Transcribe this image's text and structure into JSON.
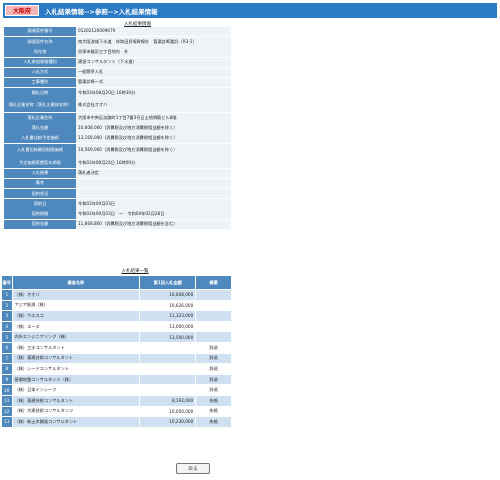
{
  "header": {
    "prefecture": "大阪府",
    "breadcrumb": "入札結果情報-->参照-->入札結果情報"
  },
  "detail": {
    "title": "入札結果情報",
    "rows": [
      {
        "label": "調達案件番号",
        "value": "01202120009679"
      },
      {
        "label": "調達案件名称",
        "value": "南大阪流域下水道　岸和田貝塚幹線外　管渠診断委託（R3-1）"
      },
      {
        "label": "所在地",
        "value": "貝塚市脇浜三丁目地内　外"
      },
      {
        "label": "入札参加資格種別",
        "value": "建設コンサルタント（下水道）"
      },
      {
        "label": "入札方式",
        "value": "一般競争入札"
      },
      {
        "label": "工事種別",
        "value": "管渠診断一式"
      },
      {
        "label": "開札日時",
        "value": "令和03年08月20日 16時30分"
      },
      {
        "label": "落札企業名称（落札企業体名称）",
        "value": "株式会社オオバ"
      },
      {
        "label": "落札企業住所",
        "value": "大阪市中央区淡路町1丁目7番3号日土地堺筋ビル8階"
      },
      {
        "label": "落札金額",
        "value": "10,608,000（消費税及び地方消費税相当額を除く）"
      },
      {
        "label": "入札書比較予定価格",
        "value": "13,169,000（消費税及び地方消費税相当額を除く）"
      },
      {
        "label": "入札書比較最低制限価格",
        "value": "10,569,000（消費税及び地方消費税相当額を除く）"
      },
      {
        "label": "予定価格等閲覧年期限",
        "value": "令和03年08月24日 16時00分"
      },
      {
        "label": "入札結果",
        "value": "落札者決定"
      },
      {
        "label": "備考",
        "value": ""
      },
      {
        "label": "契約状況",
        "value": ""
      },
      {
        "label": "契約日",
        "value": "令和03年09月03日"
      },
      {
        "label": "契約期間",
        "value": "令和03年09月03日　～　令和04年02月28日"
      },
      {
        "label": "契約金額",
        "value": "11,668,800（消費税及び地方消費税相当額を含む）"
      }
    ]
  },
  "results": {
    "title": "入札結果一覧",
    "headers": [
      "番号",
      "業者名称",
      "第1回入札金額",
      "摘要"
    ],
    "rows": [
      {
        "no": "1",
        "name": "（株）オオバ",
        "amount": "10,608,000",
        "note": ""
      },
      {
        "no": "2",
        "name": "アジア航測（株）",
        "amount": "10,626,000",
        "note": ""
      },
      {
        "no": "3",
        "name": "（株）ウエスコ",
        "amount": "11,323,000",
        "note": ""
      },
      {
        "no": "4",
        "name": "（株）エース",
        "amount": "13,000,000",
        "note": ""
      },
      {
        "no": "5",
        "name": "内外エンジニアリング（株）",
        "amount": "13,500,000",
        "note": ""
      },
      {
        "no": "6",
        "name": "（株）三水コンサルタント",
        "amount": "",
        "note": "辞退"
      },
      {
        "no": "7",
        "name": "（株）東建技術コンサルタント",
        "amount": "",
        "note": "辞退"
      },
      {
        "no": "8",
        "name": "（株）シードコンサルタント",
        "amount": "",
        "note": "辞退"
      },
      {
        "no": "9",
        "name": "基礎地盤コンサルタンツ（株）",
        "amount": "",
        "note": "辞退"
      },
      {
        "no": "10",
        "name": "（株）日本インシーク",
        "amount": "",
        "note": "辞退"
      },
      {
        "no": "11",
        "name": "（株）東建技術コンサルタント",
        "amount": "8,192,000",
        "note": "失格"
      },
      {
        "no": "12",
        "name": "（株）大建技術コンサルタンツ",
        "amount": "10,050,000",
        "note": "失格"
      },
      {
        "no": "13",
        "name": "（株）新土木開発コンサルタント",
        "amount": "10,230,000",
        "note": "失格"
      }
    ]
  },
  "back_button": "戻る"
}
